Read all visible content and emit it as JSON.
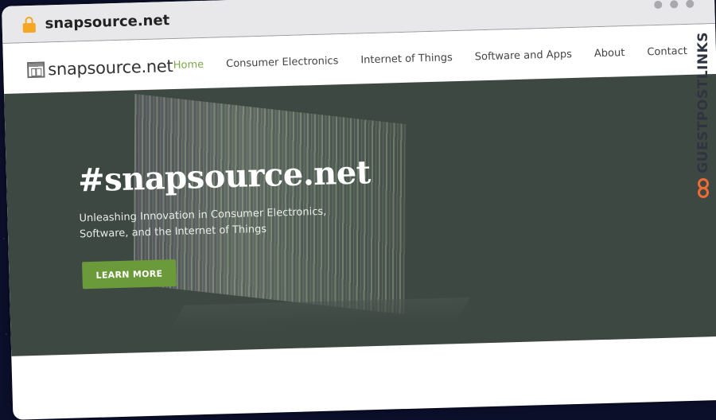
{
  "browser": {
    "url": "snapsource.net",
    "lock_icon": "lock-icon",
    "window_controls": [
      "dot",
      "dot",
      "dot"
    ]
  },
  "site": {
    "logo_text": "snapsource.net",
    "logo_icon": "website-layout-icon",
    "nav": [
      {
        "label": "Home",
        "active": true
      },
      {
        "label": "Consumer Electronics",
        "active": false
      },
      {
        "label": "Internet of Things",
        "active": false
      },
      {
        "label": "Software and Apps",
        "active": false
      },
      {
        "label": "About",
        "active": false
      },
      {
        "label": "Contact",
        "active": false
      }
    ]
  },
  "hero": {
    "title": "#snapsource.net",
    "subtitle": "Unleashing Innovation in Consumer Electronics, Software, and the Internet of Things",
    "cta_label": "LEARN MORE"
  },
  "watermark": {
    "text_part1": "GUEST",
    "text_part2": "POSTLINKS",
    "icon": "chain-link-icon"
  },
  "colors": {
    "accent_green": "#7aa84a",
    "button_green": "#6a9a3a",
    "hero_bg": "#3e4843",
    "lock_orange": "#f5a623",
    "watermark_orange": "#f06a35"
  }
}
